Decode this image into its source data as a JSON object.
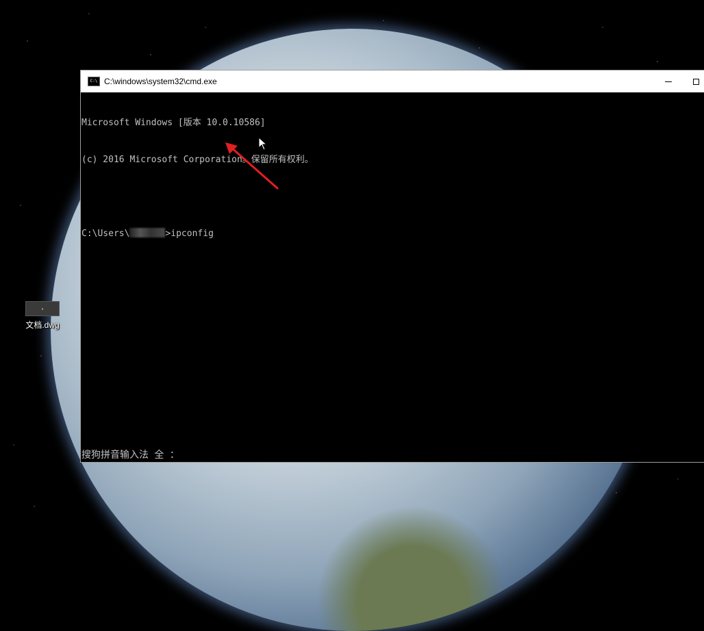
{
  "desktop": {
    "icon_label": "文档.dwg"
  },
  "window": {
    "title": "C:\\windows\\system32\\cmd.exe"
  },
  "console": {
    "lines": [
      "Microsoft Windows [版本 10.0.10586]",
      "(c) 2016 Microsoft Corporation。保留所有权利。",
      "",
      "C:\\Users\\"
    ],
    "command_suffix": ">ipconfig"
  },
  "ime": {
    "status": "搜狗拼音输入法 全 ："
  },
  "colors": {
    "annotation_arrow": "#e02020",
    "console_text": "#c0c0c0",
    "console_bg": "#000000"
  }
}
